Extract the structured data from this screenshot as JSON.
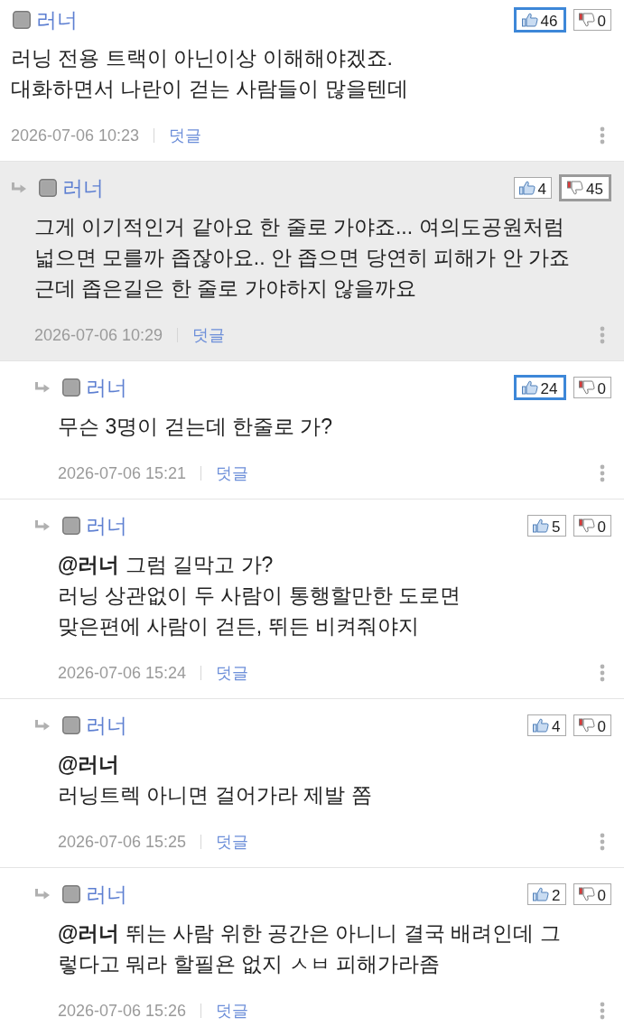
{
  "comments": [
    {
      "author": "러너",
      "highlighted": false,
      "votes": [
        {
          "kind": "like",
          "count": "46",
          "emphasized": true
        },
        {
          "kind": "dislike",
          "count": "0",
          "emphasized": false
        }
      ],
      "text": "러닝 전용 트랙이 아닌이상 이해해야겠죠.\n대화하면서 나란이 걷는 사람들이 많을텐데",
      "date": "2026-07-06 10:23",
      "reply_label": "덧글",
      "children": [
        {
          "author": "러너",
          "highlighted": true,
          "votes": [
            {
              "kind": "like",
              "count": "4",
              "emphasized": false
            },
            {
              "kind": "dislike",
              "count": "45",
              "emphasized": true
            }
          ],
          "text": "그게 이기적인거 같아요 한 줄로 가야죠... 여의도공원처럼\n넓으면 모를까 좁잖아요.. 안 좁으면 당연히 피해가 안 가죠\n근데 좁은길은 한 줄로 가야하지 않을까요",
          "date": "2026-07-06 10:29",
          "reply_label": "덧글",
          "children": [
            {
              "author": "러너",
              "highlighted": false,
              "votes": [
                {
                  "kind": "like",
                  "count": "24",
                  "emphasized": true
                },
                {
                  "kind": "dislike",
                  "count": "0",
                  "emphasized": false
                }
              ],
              "text": "무슨 3명이 걷는데 한줄로 가?",
              "date": "2026-07-06 15:21",
              "reply_label": "덧글"
            },
            {
              "author": "러너",
              "highlighted": false,
              "votes": [
                {
                  "kind": "like",
                  "count": "5",
                  "emphasized": false
                },
                {
                  "kind": "dislike",
                  "count": "0",
                  "emphasized": false
                }
              ],
              "text": "**@러너** 그럼 길막고 가?\n러닝 상관없이 두 사람이 통행할만한 도로면\n맞은편에 사람이 걷든, 뛰든 비켜줘야지",
              "date": "2026-07-06 15:24",
              "reply_label": "덧글"
            },
            {
              "author": "러너",
              "highlighted": false,
              "votes": [
                {
                  "kind": "like",
                  "count": "4",
                  "emphasized": false
                },
                {
                  "kind": "dislike",
                  "count": "0",
                  "emphasized": false
                }
              ],
              "text": "**@러너**\n러닝트렉 아니면 걸어가라 제발 쫌",
              "date": "2026-07-06 15:25",
              "reply_label": "덧글"
            },
            {
              "author": "러너",
              "highlighted": false,
              "votes": [
                {
                  "kind": "like",
                  "count": "2",
                  "emphasized": false
                },
                {
                  "kind": "dislike",
                  "count": "0",
                  "emphasized": false
                }
              ],
              "text": "**@러너** 뛰는 사람 위한 공간은 아니니 결국 배려인데 그\n렇다고 뭐라 할필욘 없지 ㅅㅂ 피해가라좀",
              "date": "2026-07-06 15:26",
              "reply_label": "덧글"
            }
          ]
        }
      ]
    }
  ]
}
